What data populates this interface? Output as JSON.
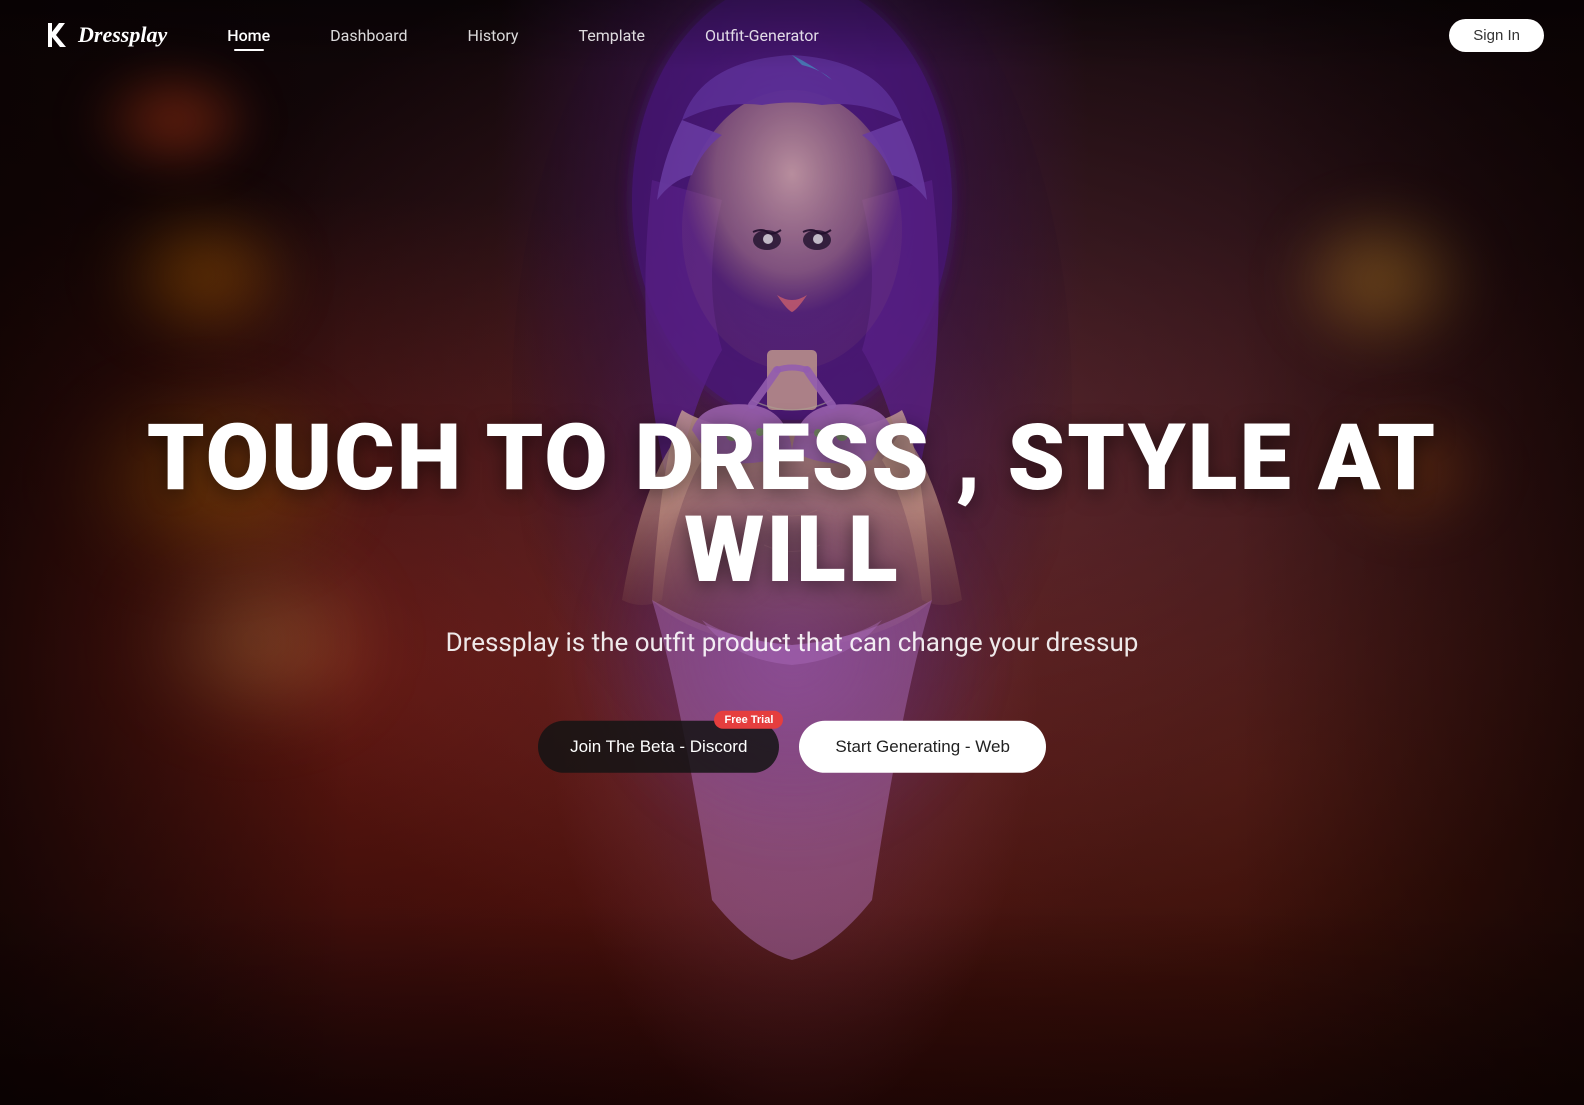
{
  "brand": {
    "name": "Dressplay",
    "logo_alt": "Dressplay Logo"
  },
  "nav": {
    "links": [
      {
        "id": "home",
        "label": "Home",
        "active": true
      },
      {
        "id": "dashboard",
        "label": "Dashboard",
        "active": false
      },
      {
        "id": "history",
        "label": "History",
        "active": false
      },
      {
        "id": "template",
        "label": "Template",
        "active": false
      },
      {
        "id": "outfit-generator",
        "label": "Outfit-Generator",
        "active": false
      }
    ],
    "signin_label": "Sign In"
  },
  "hero": {
    "title": "TOUCH TO DRESS , STYLE AT WILL",
    "subtitle": "Dressplay is the outfit product that can change your dressup",
    "cta": {
      "discord_label": "Join The Beta - Discord",
      "free_trial_badge": "Free Trial",
      "start_label": "Start Generating - Web"
    }
  },
  "colors": {
    "accent_red": "#e53e3e",
    "nav_bg": "rgba(0,0,0,0.3)",
    "white": "#ffffff",
    "dark_btn": "rgba(20,20,20,0.85)"
  }
}
